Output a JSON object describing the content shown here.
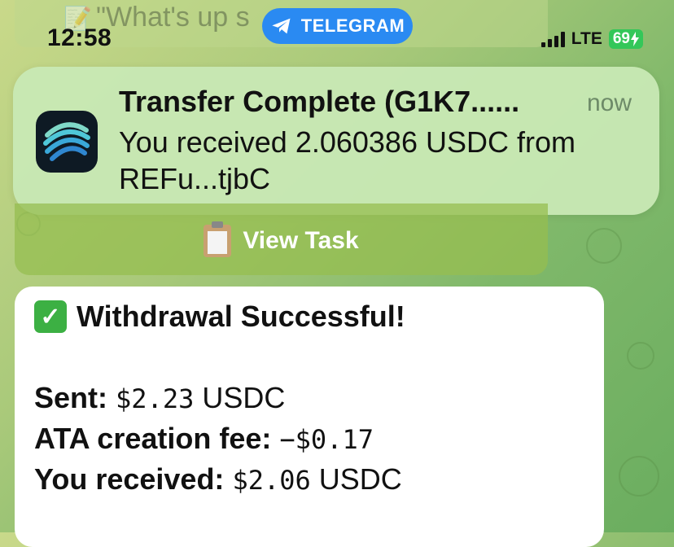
{
  "status_bar": {
    "time": "12:58",
    "app_pill": "TELEGRAM",
    "network": "LTE",
    "battery": "69"
  },
  "background_message": {
    "text": "\"What's up s"
  },
  "notification": {
    "title": "Transfer Complete (G1K7......",
    "time": "now",
    "body": "You received 2.060386 USDC from REFu...tjbC"
  },
  "view_task_button": {
    "label": "View Task"
  },
  "message": {
    "title": "Withdrawal Successful!",
    "rows": [
      {
        "label": "Sent:",
        "value": "$2.23",
        "unit": "USDC"
      },
      {
        "label": "ATA creation fee:",
        "value": "−$0.17",
        "unit": ""
      },
      {
        "label": "You received:",
        "value": "$2.06",
        "unit": "USDC"
      }
    ]
  },
  "colors": {
    "telegram_blue": "#2a8af2",
    "battery_green": "#34c759",
    "check_green": "#3cb043"
  }
}
